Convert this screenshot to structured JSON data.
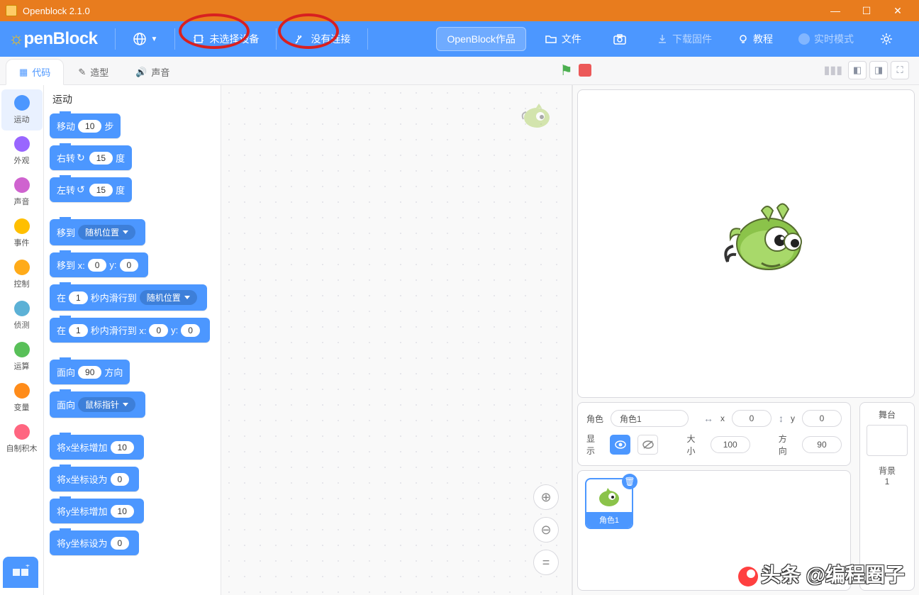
{
  "window": {
    "title": "Openblock 2.1.0"
  },
  "menubar": {
    "logo_prefix": "pen",
    "logo_suffix": "Block",
    "device_label": "未选择设备",
    "connect_label": "没有连接",
    "project_name": "OpenBlock作品",
    "file_label": "文件",
    "firmware_label": "下载固件",
    "tutorial_label": "教程",
    "mode_label": "实时模式"
  },
  "tabs": {
    "code": "代码",
    "costumes": "造型",
    "sounds": "声音"
  },
  "categories": [
    {
      "name": "运动",
      "color": "#4c97ff"
    },
    {
      "name": "外观",
      "color": "#9966ff"
    },
    {
      "name": "声音",
      "color": "#cf63cf"
    },
    {
      "name": "事件",
      "color": "#ffbf00"
    },
    {
      "name": "控制",
      "color": "#ffab19"
    },
    {
      "name": "侦测",
      "color": "#5cb1d6"
    },
    {
      "name": "运算",
      "color": "#59c059"
    },
    {
      "name": "变量",
      "color": "#ff8c1a"
    },
    {
      "name": "自制积木",
      "color": "#ff6680"
    }
  ],
  "palette": {
    "header": "运动",
    "blocks": {
      "move": {
        "pre": "移动",
        "val": "10",
        "post": "步"
      },
      "turn_r": {
        "pre": "右转",
        "val": "15",
        "post": "度"
      },
      "turn_l": {
        "pre": "左转",
        "val": "15",
        "post": "度"
      },
      "goto_menu": {
        "pre": "移到",
        "opt": "随机位置"
      },
      "goto_xy": {
        "pre": "移到 x:",
        "x": "0",
        "mid": "y:",
        "y": "0"
      },
      "glide_menu": {
        "pre": "在",
        "secs": "1",
        "mid": "秒内滑行到",
        "opt": "随机位置"
      },
      "glide_xy": {
        "pre": "在",
        "secs": "1",
        "mid": "秒内滑行到 x:",
        "x": "0",
        "mid2": "y:",
        "y": "0"
      },
      "point_dir": {
        "pre": "面向",
        "val": "90",
        "post": "方向"
      },
      "point_to": {
        "pre": "面向",
        "opt": "鼠标指针"
      },
      "change_x": {
        "pre": "将x坐标增加",
        "val": "10"
      },
      "set_x": {
        "pre": "将x坐标设为",
        "val": "0"
      },
      "change_y": {
        "pre": "将y坐标增加",
        "val": "10"
      },
      "set_y": {
        "pre": "将y坐标设为",
        "val": "0"
      }
    }
  },
  "sprite_info": {
    "sprite_label": "角色",
    "sprite_name": "角色1",
    "x_label": "x",
    "x_val": "0",
    "y_label": "y",
    "y_val": "0",
    "show_label": "显示",
    "size_label": "大小",
    "size_val": "100",
    "dir_label": "方向",
    "dir_val": "90"
  },
  "sprite_card": {
    "name": "角色1"
  },
  "stage_panel": {
    "title": "舞台",
    "bg_label": "背景",
    "bg_count": "1"
  },
  "watermark": "头条 @编程圈子"
}
